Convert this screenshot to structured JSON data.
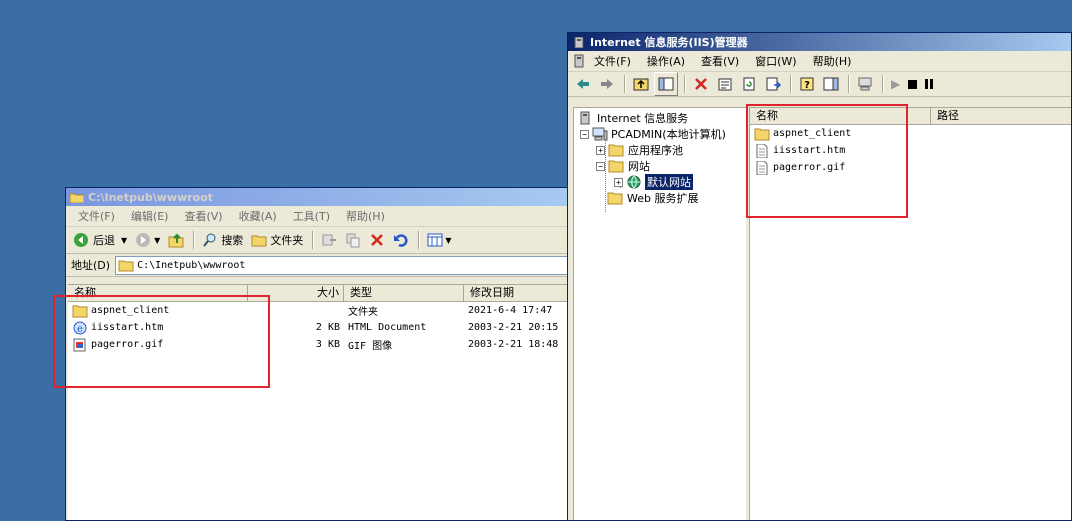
{
  "explorer": {
    "title": "C:\\Inetpub\\wwwroot",
    "menu": [
      "文件(F)",
      "编辑(E)",
      "查看(V)",
      "收藏(A)",
      "工具(T)",
      "帮助(H)"
    ],
    "toolbar": {
      "back": "后退",
      "search": "搜索",
      "folders": "文件夹"
    },
    "address_label": "地址(D)",
    "address_value": "C:\\Inetpub\\wwwroot",
    "columns": [
      "名称",
      "大小",
      "类型",
      "修改日期"
    ],
    "rows": [
      {
        "name": "aspnet_client",
        "size": "",
        "type": "文件夹",
        "date": "2021-6-4 17:47",
        "icon": "folder-icon"
      },
      {
        "name": "iisstart.htm",
        "size": "2 KB",
        "type": "HTML Document",
        "date": "2003-2-21 20:15",
        "icon": "html-file-icon"
      },
      {
        "name": "pagerror.gif",
        "size": "3 KB",
        "type": "GIF 图像",
        "date": "2003-2-21 18:48",
        "icon": "gif-file-icon"
      }
    ]
  },
  "iis": {
    "title": "Internet 信息服务(IIS)管理器",
    "menu": [
      "文件(F)",
      "操作(A)",
      "查看(V)",
      "窗口(W)",
      "帮助(H)"
    ],
    "tree": {
      "root": "Internet 信息服务",
      "computer": "PCADMIN(本地计算机)",
      "app_pools": "应用程序池",
      "websites": "网站",
      "default_site": "默认网站",
      "web_ext": "Web 服务扩展"
    },
    "columns": [
      "名称",
      "路径"
    ],
    "items": [
      "aspnet_client",
      "iisstart.htm",
      "pagerror.gif"
    ]
  },
  "colors": {
    "desktop": "#3a6ea5",
    "highlight": "#e0242f",
    "selection": "#0a246a"
  }
}
